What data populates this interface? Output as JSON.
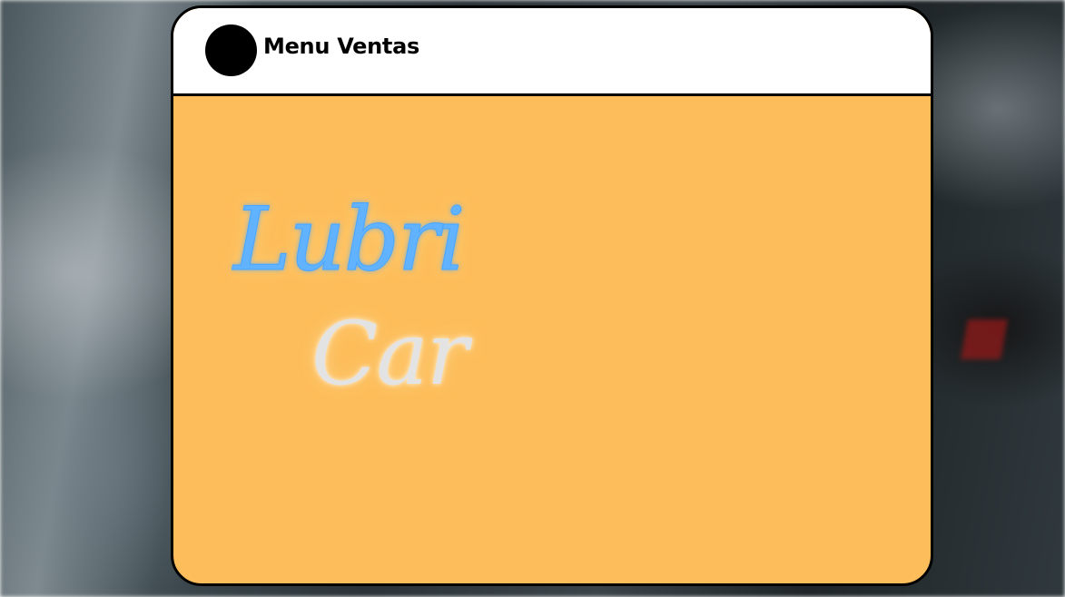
{
  "header": {
    "title": "Menu Ventas"
  },
  "logo": {
    "line1": "Lubri",
    "line2": "Car"
  },
  "colors": {
    "panel_background": "#fdbd5a",
    "header_background": "#ffffff",
    "logo_line1": "#62b3ff",
    "logo_line2": "#e3e3e3"
  }
}
